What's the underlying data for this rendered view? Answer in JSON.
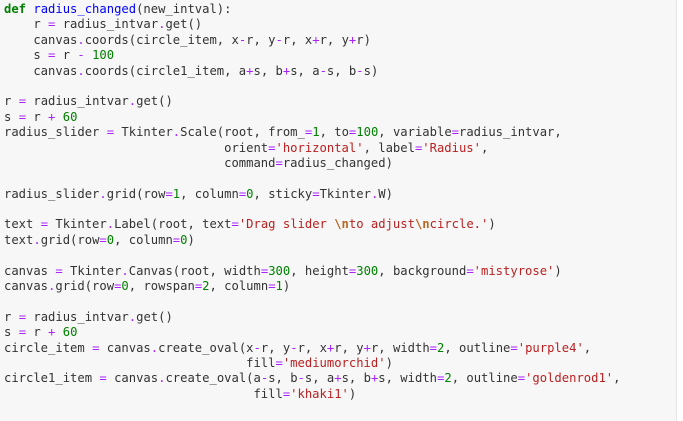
{
  "code_cell": {
    "lines": [
      [
        [
          "kw",
          "def"
        ],
        [
          "plain",
          " "
        ],
        [
          "def",
          "radius_changed"
        ],
        [
          "plain",
          "(new_intval):"
        ]
      ],
      [
        [
          "plain",
          "    r "
        ],
        [
          "op",
          "="
        ],
        [
          "plain",
          " radius_intvar"
        ],
        [
          "op",
          "."
        ],
        [
          "plain",
          "get()"
        ]
      ],
      [
        [
          "plain",
          "    canvas"
        ],
        [
          "op",
          "."
        ],
        [
          "plain",
          "coords(circle_item, x"
        ],
        [
          "op",
          "-"
        ],
        [
          "plain",
          "r, y"
        ],
        [
          "op",
          "-"
        ],
        [
          "plain",
          "r, x"
        ],
        [
          "op",
          "+"
        ],
        [
          "plain",
          "r, y"
        ],
        [
          "op",
          "+"
        ],
        [
          "plain",
          "r)"
        ]
      ],
      [
        [
          "plain",
          "    s "
        ],
        [
          "op",
          "="
        ],
        [
          "plain",
          " r "
        ],
        [
          "op",
          "-"
        ],
        [
          "plain",
          " "
        ],
        [
          "num",
          "100"
        ]
      ],
      [
        [
          "plain",
          "    canvas"
        ],
        [
          "op",
          "."
        ],
        [
          "plain",
          "coords(circle1_item, a"
        ],
        [
          "op",
          "+"
        ],
        [
          "plain",
          "s, b"
        ],
        [
          "op",
          "+"
        ],
        [
          "plain",
          "s, a"
        ],
        [
          "op",
          "-"
        ],
        [
          "plain",
          "s, b"
        ],
        [
          "op",
          "-"
        ],
        [
          "plain",
          "s)"
        ]
      ],
      [],
      [
        [
          "plain",
          "r "
        ],
        [
          "op",
          "="
        ],
        [
          "plain",
          " radius_intvar"
        ],
        [
          "op",
          "."
        ],
        [
          "plain",
          "get()"
        ]
      ],
      [
        [
          "plain",
          "s "
        ],
        [
          "op",
          "="
        ],
        [
          "plain",
          " r "
        ],
        [
          "op",
          "+"
        ],
        [
          "plain",
          " "
        ],
        [
          "num",
          "60"
        ]
      ],
      [
        [
          "plain",
          "radius_slider "
        ],
        [
          "op",
          "="
        ],
        [
          "plain",
          " Tkinter"
        ],
        [
          "op",
          "."
        ],
        [
          "plain",
          "Scale(root, from_"
        ],
        [
          "op",
          "="
        ],
        [
          "num",
          "1"
        ],
        [
          "plain",
          ", to"
        ],
        [
          "op",
          "="
        ],
        [
          "num",
          "100"
        ],
        [
          "plain",
          ", variable"
        ],
        [
          "op",
          "="
        ],
        [
          "plain",
          "radius_intvar,"
        ]
      ],
      [
        [
          "plain",
          "                              orient"
        ],
        [
          "op",
          "="
        ],
        [
          "str",
          "'horizontal'"
        ],
        [
          "plain",
          ", label"
        ],
        [
          "op",
          "="
        ],
        [
          "str",
          "'Radius'"
        ],
        [
          "plain",
          ","
        ]
      ],
      [
        [
          "plain",
          "                              command"
        ],
        [
          "op",
          "="
        ],
        [
          "plain",
          "radius_changed)"
        ]
      ],
      [],
      [
        [
          "plain",
          "radius_slider"
        ],
        [
          "op",
          "."
        ],
        [
          "plain",
          "grid(row"
        ],
        [
          "op",
          "="
        ],
        [
          "num",
          "1"
        ],
        [
          "plain",
          ", column"
        ],
        [
          "op",
          "="
        ],
        [
          "num",
          "0"
        ],
        [
          "plain",
          ", sticky"
        ],
        [
          "op",
          "="
        ],
        [
          "plain",
          "Tkinter"
        ],
        [
          "op",
          "."
        ],
        [
          "plain",
          "W)"
        ]
      ],
      [],
      [
        [
          "plain",
          "text "
        ],
        [
          "op",
          "="
        ],
        [
          "plain",
          " Tkinter"
        ],
        [
          "op",
          "."
        ],
        [
          "plain",
          "Label(root, text"
        ],
        [
          "op",
          "="
        ],
        [
          "str",
          "'Drag slider "
        ],
        [
          "esc",
          "\\n"
        ],
        [
          "str",
          "to adjust"
        ],
        [
          "esc",
          "\\n"
        ],
        [
          "str",
          "circle.'"
        ],
        [
          "plain",
          ")"
        ]
      ],
      [
        [
          "plain",
          "text"
        ],
        [
          "op",
          "."
        ],
        [
          "plain",
          "grid(row"
        ],
        [
          "op",
          "="
        ],
        [
          "num",
          "0"
        ],
        [
          "plain",
          ", column"
        ],
        [
          "op",
          "="
        ],
        [
          "num",
          "0"
        ],
        [
          "plain",
          ")"
        ]
      ],
      [],
      [
        [
          "plain",
          "canvas "
        ],
        [
          "op",
          "="
        ],
        [
          "plain",
          " Tkinter"
        ],
        [
          "op",
          "."
        ],
        [
          "plain",
          "Canvas(root, width"
        ],
        [
          "op",
          "="
        ],
        [
          "num",
          "300"
        ],
        [
          "plain",
          ", height"
        ],
        [
          "op",
          "="
        ],
        [
          "num",
          "300"
        ],
        [
          "plain",
          ", background"
        ],
        [
          "op",
          "="
        ],
        [
          "str",
          "'mistyrose'"
        ],
        [
          "plain",
          ")"
        ]
      ],
      [
        [
          "plain",
          "canvas"
        ],
        [
          "op",
          "."
        ],
        [
          "plain",
          "grid(row"
        ],
        [
          "op",
          "="
        ],
        [
          "num",
          "0"
        ],
        [
          "plain",
          ", rowspan"
        ],
        [
          "op",
          "="
        ],
        [
          "num",
          "2"
        ],
        [
          "plain",
          ", column"
        ],
        [
          "op",
          "="
        ],
        [
          "num",
          "1"
        ],
        [
          "plain",
          ")"
        ]
      ],
      [],
      [
        [
          "plain",
          "r "
        ],
        [
          "op",
          "="
        ],
        [
          "plain",
          " radius_intvar"
        ],
        [
          "op",
          "."
        ],
        [
          "plain",
          "get()"
        ]
      ],
      [
        [
          "plain",
          "s "
        ],
        [
          "op",
          "="
        ],
        [
          "plain",
          " r "
        ],
        [
          "op",
          "+"
        ],
        [
          "plain",
          " "
        ],
        [
          "num",
          "60"
        ]
      ],
      [
        [
          "plain",
          "circle_item "
        ],
        [
          "op",
          "="
        ],
        [
          "plain",
          " canvas"
        ],
        [
          "op",
          "."
        ],
        [
          "plain",
          "create_oval(x"
        ],
        [
          "op",
          "-"
        ],
        [
          "plain",
          "r, y"
        ],
        [
          "op",
          "-"
        ],
        [
          "plain",
          "r, x"
        ],
        [
          "op",
          "+"
        ],
        [
          "plain",
          "r, y"
        ],
        [
          "op",
          "+"
        ],
        [
          "plain",
          "r, width"
        ],
        [
          "op",
          "="
        ],
        [
          "num",
          "2"
        ],
        [
          "plain",
          ", outline"
        ],
        [
          "op",
          "="
        ],
        [
          "str",
          "'purple4'"
        ],
        [
          "plain",
          ","
        ]
      ],
      [
        [
          "plain",
          "                                 fill"
        ],
        [
          "op",
          "="
        ],
        [
          "str",
          "'mediumorchid'"
        ],
        [
          "plain",
          ")"
        ]
      ],
      [
        [
          "plain",
          "circle1_item "
        ],
        [
          "op",
          "="
        ],
        [
          "plain",
          " canvas"
        ],
        [
          "op",
          "."
        ],
        [
          "plain",
          "create_oval(a"
        ],
        [
          "op",
          "-"
        ],
        [
          "plain",
          "s, b"
        ],
        [
          "op",
          "-"
        ],
        [
          "plain",
          "s, a"
        ],
        [
          "op",
          "+"
        ],
        [
          "plain",
          "s, b"
        ],
        [
          "op",
          "+"
        ],
        [
          "plain",
          "s, width"
        ],
        [
          "op",
          "="
        ],
        [
          "num",
          "2"
        ],
        [
          "plain",
          ", outline"
        ],
        [
          "op",
          "="
        ],
        [
          "str",
          "'goldenrod1'"
        ],
        [
          "plain",
          ","
        ]
      ],
      [
        [
          "plain",
          "                                  fill"
        ],
        [
          "op",
          "="
        ],
        [
          "str",
          "'khaki1'"
        ],
        [
          "plain",
          ")"
        ]
      ]
    ]
  }
}
